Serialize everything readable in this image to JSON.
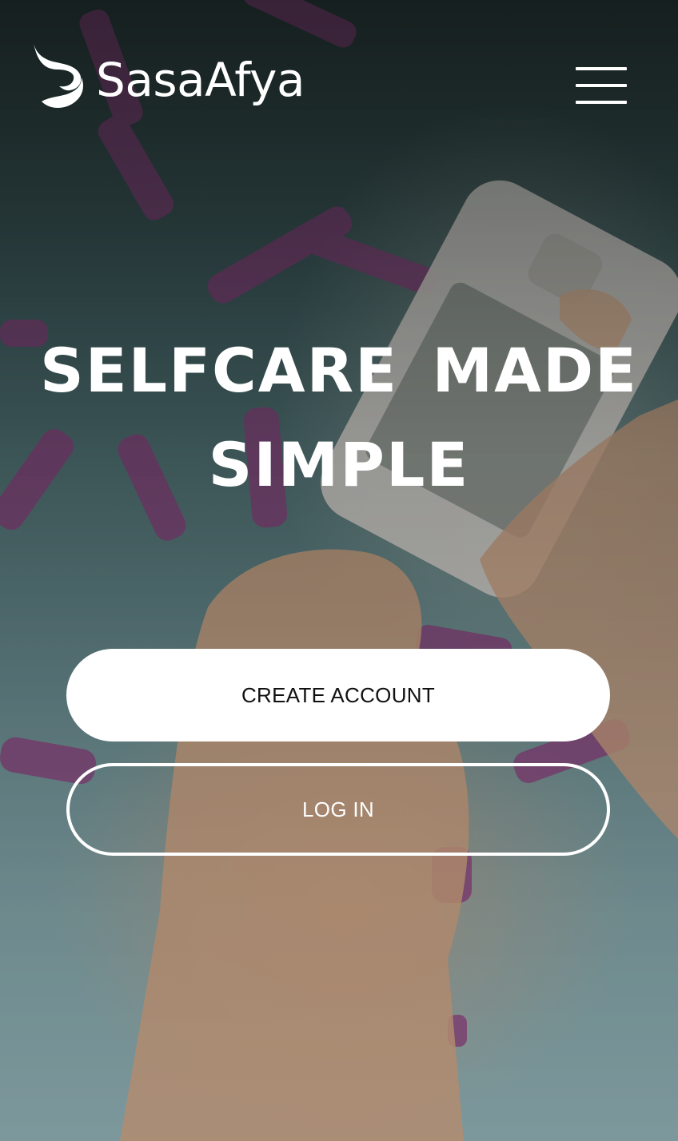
{
  "header": {
    "brand_name": "SasaAfya",
    "menu_icon": "hamburger-menu-icon"
  },
  "hero": {
    "headline_line1": "SELFCARE MADE",
    "headline_line2": "SIMPLE",
    "background": "photo of hands holding a glucose meter with lancets"
  },
  "actions": {
    "create_account_label": "CREATE ACCOUNT",
    "login_label": "LOG IN"
  },
  "colors": {
    "text": "#ffffff",
    "primary_button_bg": "#ffffff",
    "primary_button_text": "#111111"
  }
}
